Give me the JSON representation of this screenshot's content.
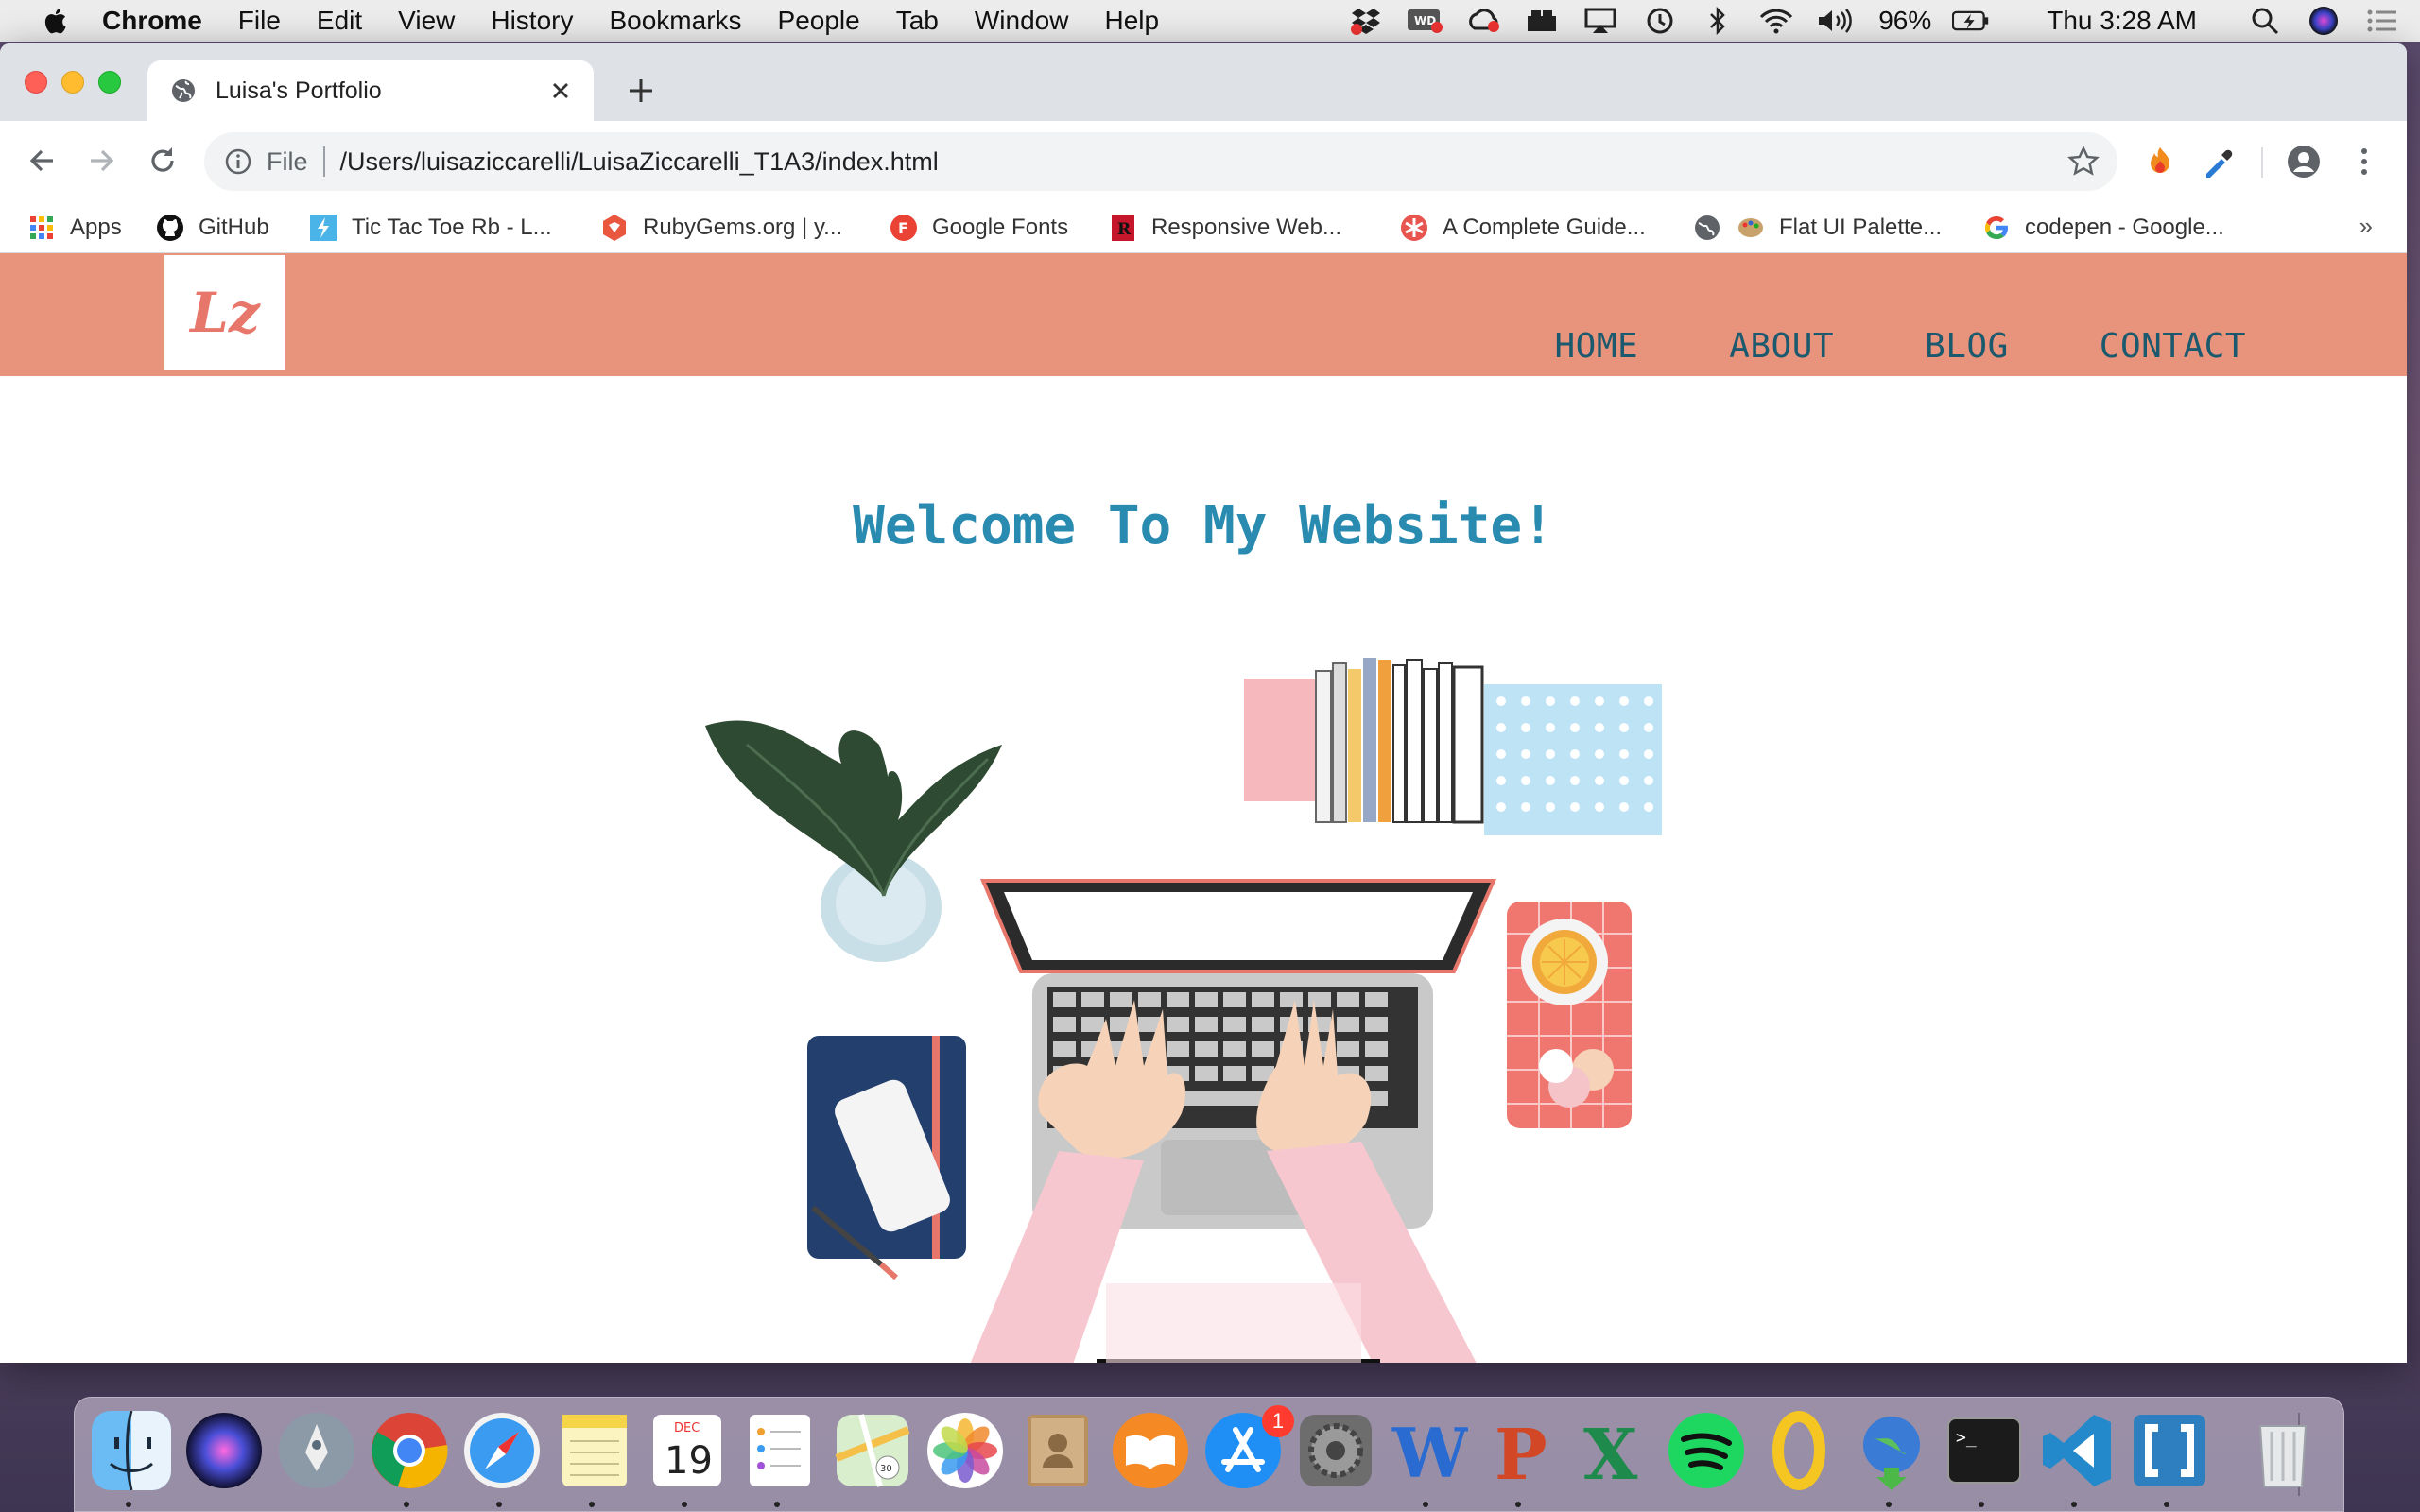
{
  "menubar": {
    "app_name": "Chrome",
    "menus": [
      "File",
      "Edit",
      "View",
      "History",
      "Bookmarks",
      "People",
      "Tab",
      "Window",
      "Help"
    ],
    "battery": "96%",
    "clock": "Thu 3:28 AM"
  },
  "browser": {
    "tab_title": "Luisa's Portfolio",
    "scheme_label": "File",
    "url": "/Users/luisaziccarelli/LuisaZiccarelli_T1A3/index.html",
    "bookmarks": [
      "Apps",
      "GitHub",
      "Tic Tac Toe Rb - L...",
      "RubyGems.org | y...",
      "Google Fonts",
      "Responsive Web...",
      "A Complete Guide...",
      "Flat UI Palette...",
      "codepen - Google..."
    ],
    "bookmarks_overflow": "»"
  },
  "site": {
    "logo_text": "Lz",
    "nav": [
      "HOME",
      "ABOUT",
      "BLOG",
      "CONTACT"
    ],
    "welcome": "Welcome To My Website!"
  },
  "dock": {
    "calendar_month": "DEC",
    "calendar_day": "19",
    "app_store_badge": "1"
  },
  "colors": {
    "header": "#e8937b",
    "nav_text": "#1b5a6e",
    "welcome_text": "#2a8bb0",
    "logo_text": "#e8776b"
  }
}
